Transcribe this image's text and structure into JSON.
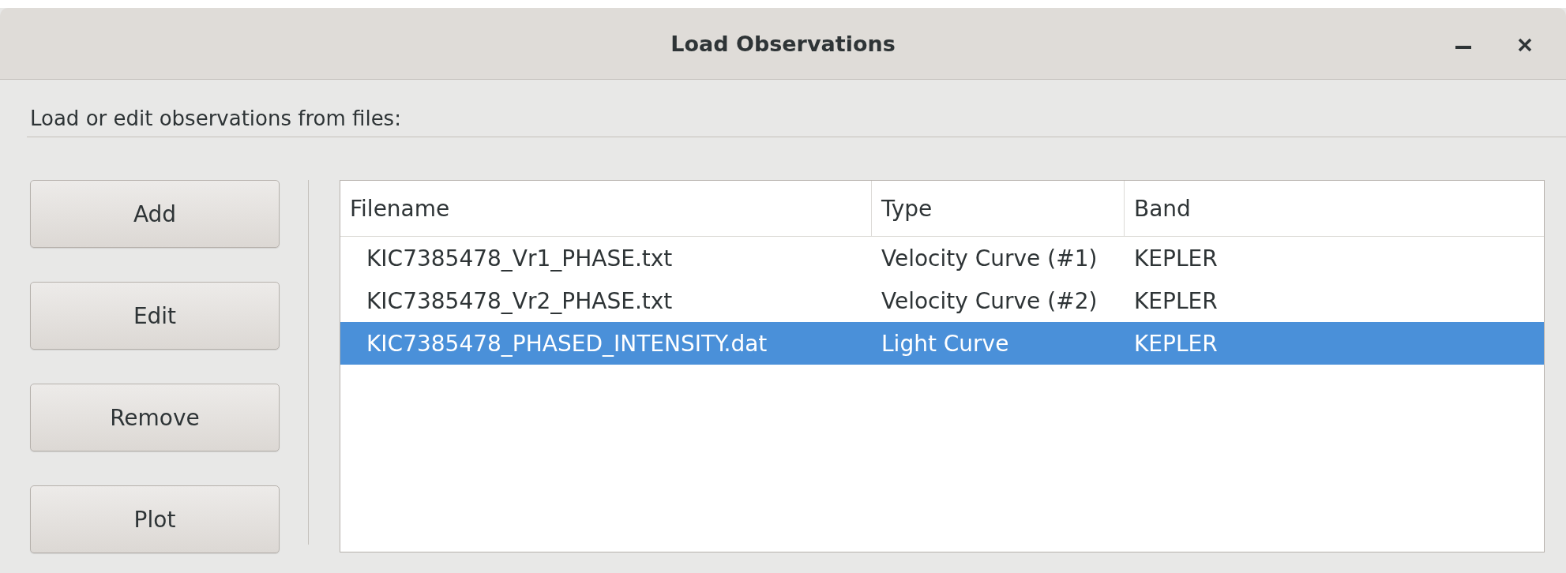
{
  "window": {
    "title": "Load Observations"
  },
  "instruction": "Load or edit observations from files:",
  "buttons": [
    "Add",
    "Edit",
    "Remove",
    "Plot"
  ],
  "table": {
    "columns": [
      "Filename",
      "Type",
      "Band"
    ],
    "rows": [
      {
        "cells": [
          "KIC7385478_Vr1_PHASE.txt",
          "Velocity Curve (#1)",
          "KEPLER"
        ],
        "selected": false
      },
      {
        "cells": [
          "KIC7385478_Vr2_PHASE.txt",
          "Velocity Curve (#2)",
          "KEPLER"
        ],
        "selected": false
      },
      {
        "cells": [
          "KIC7385478_PHASED_INTENSITY.dat",
          "Light Curve",
          "KEPLER"
        ],
        "selected": true
      }
    ]
  }
}
